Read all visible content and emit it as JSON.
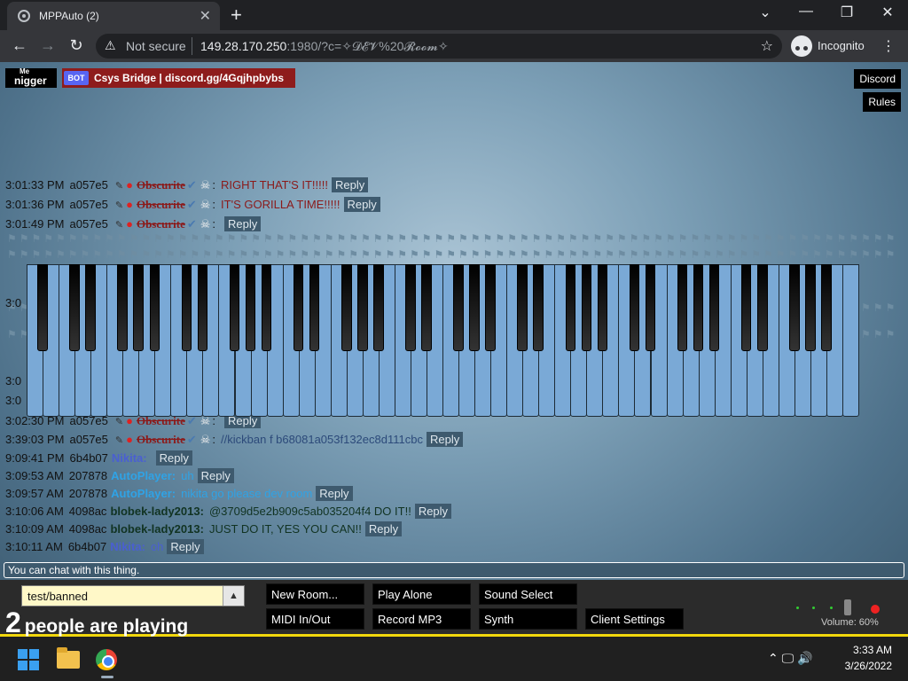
{
  "browser": {
    "tab_title": "MPPAuto (2)",
    "tab_close": "✕",
    "new_tab": "+",
    "minimize": "—",
    "restore": "❐",
    "close": "✕",
    "back": "←",
    "forward": "→",
    "reload": "↻",
    "not_secure": "Not secure",
    "url_host": "149.28.170.250",
    "url_path": ":1980/?c=✧𝓓𝓔𝓥%20𝓡𝓸𝓸𝓶✧",
    "star": "☆",
    "incognito": "Incognito",
    "menu": "⋮"
  },
  "header": {
    "me_label": "Me",
    "me_name": "nigger",
    "bot_tag": "BOT",
    "bot_name": "Csys Bridge | discord.gg/4Gqjhpbybs",
    "discord_button": "Discord",
    "rules_button": "Rules"
  },
  "chat": {
    "reply_label": "Reply",
    "messages": [
      {
        "time": "3:01:33 PM",
        "uid": "a057e5",
        "name": "Obscurite",
        "text": "RIGHT THAT'S IT!!!!!",
        "name_color": "#8b1a1a",
        "text_color": "#8b1a1a"
      },
      {
        "time": "3:01:36 PM",
        "uid": "a057e5",
        "name": "Obscurite",
        "text": "IT'S GORILLA TIME!!!!!",
        "name_color": "#8b1a1a",
        "text_color": "#8b1a1a"
      },
      {
        "time": "3:01:49 PM",
        "uid": "a057e5",
        "name": "Obscurite",
        "text": "",
        "name_color": "#8b1a1a",
        "text_color": "#8b1a1a"
      },
      {
        "time": "3:02:30 PM",
        "uid": "a057e5",
        "name": "Obscurite",
        "text": "",
        "name_color": "#8b1a1a",
        "text_color": "#8b1a1a"
      },
      {
        "time": "3:39:03 PM",
        "uid": "a057e5",
        "name": "Obscurite",
        "text": "//kickban f b68081a053f132ec8d111cbc",
        "name_color": "#8b1a1a",
        "text_color": "#2c4a7a"
      },
      {
        "time": "9:09:41 PM",
        "uid": "6b4b07",
        "name": "Nikita:",
        "text": "",
        "name_color": "#4a5fd1",
        "text_color": "#4a5fd1"
      },
      {
        "time": "3:09:53 AM",
        "uid": "207878",
        "name": "AutoPlayer:",
        "text": "uh",
        "name_color": "#2fa3e6",
        "text_color": "#2fa3e6"
      },
      {
        "time": "3:09:57 AM",
        "uid": "207878",
        "name": "AutoPlayer:",
        "text": "nikita go please dev room",
        "name_color": "#2fa3e6",
        "text_color": "#2fa3e6"
      },
      {
        "time": "3:10:06 AM",
        "uid": "4098ac",
        "name": "blobek-lady2013:",
        "text": "@3709d5e2b909c5ab035204f4 DO IT!!",
        "name_color": "#113322",
        "text_color": "#113322"
      },
      {
        "time": "3:10:09 AM",
        "uid": "4098ac",
        "name": "blobek-lady2013:",
        "text": "JUST DO IT, YES YOU CAN!!",
        "name_color": "#113322",
        "text_color": "#113322"
      },
      {
        "time": "3:10:11 AM",
        "uid": "6b4b07",
        "name": "Nikita:",
        "text": "oh",
        "name_color": "#4a5fd1",
        "text_color": "#4a5fd1"
      }
    ],
    "partial_times": [
      "3:0",
      "3:0",
      "3:0"
    ],
    "input_placeholder": "You can chat with this thing."
  },
  "controls": {
    "room_name": "test/banned",
    "room_arrow": "▲",
    "player_count": "2",
    "players_text": "people are playing",
    "buttons_row1": [
      "New Room...",
      "Play Alone",
      "Sound Select"
    ],
    "buttons_row2": [
      "MIDI In/Out",
      "Record MP3",
      "Synth",
      "Client Settings"
    ],
    "volume_label": "Volume: 60%",
    "volume_level": 0.6
  },
  "taskbar": {
    "tray_icons": "⌃  🖵  🔊",
    "time": "3:33 AM",
    "date": "3/26/2022"
  },
  "colors": {
    "accent_yellow": "#f1d70c",
    "bot_badge": "#8e1c1c",
    "key_white": "#7aa9d6"
  }
}
